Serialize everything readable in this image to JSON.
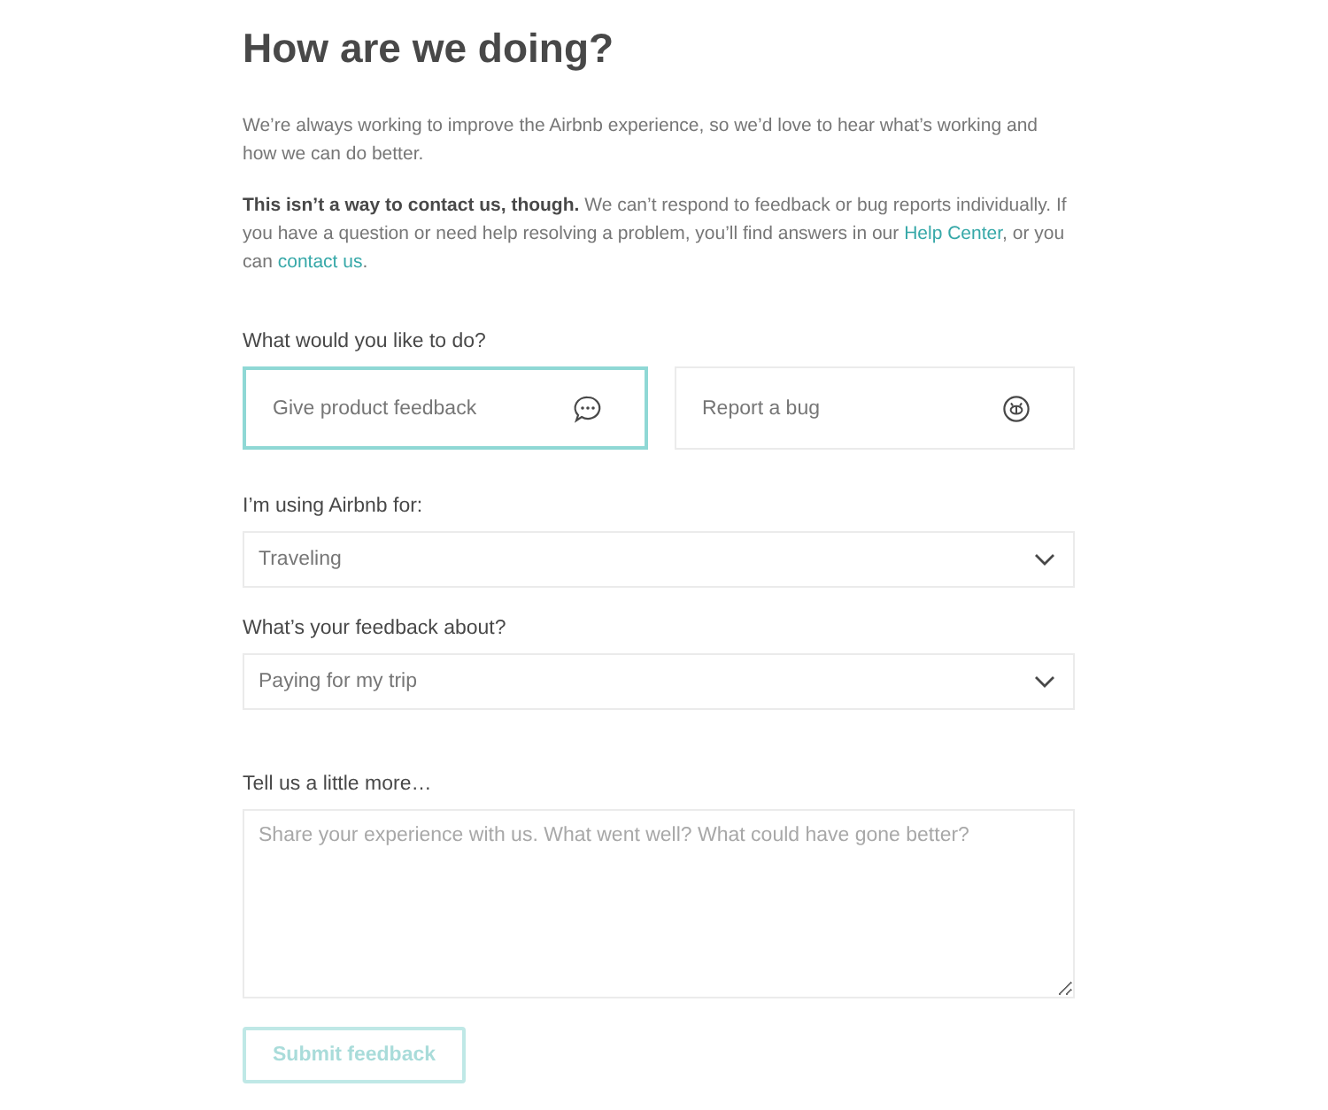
{
  "title": "How are we doing?",
  "intro": "We’re always working to improve the Airbnb experience, so we’d love to hear what’s working and how we can do better.",
  "notice": [
    {
      "kind": "bold",
      "text": "This isn’t a way to contact us, though."
    },
    {
      "kind": "text",
      "text": " We can’t respond to feedback or bug reports individually. If you have a question or need help resolving a problem, you’ll find answers in our "
    },
    {
      "kind": "link",
      "text": "Help Center"
    },
    {
      "kind": "text",
      "text": ", or you can "
    },
    {
      "kind": "link",
      "text": "contact us"
    },
    {
      "kind": "text",
      "text": "."
    }
  ],
  "action": {
    "label": "What would you like to do?",
    "options": [
      {
        "label": "Give product feedback",
        "kind": "chat",
        "selected": true
      },
      {
        "label": "Report a bug",
        "kind": "bug",
        "selected": false
      }
    ]
  },
  "selects": [
    {
      "label": "I’m using Airbnb for:",
      "value": "Traveling"
    },
    {
      "label": "What’s your feedback about?",
      "value": "Paying for my trip"
    }
  ],
  "details": {
    "label": "Tell us a little more…",
    "placeholder": "Share your experience with us. What went well? What could have gone better?"
  },
  "submit": {
    "label": "Submit feedback",
    "disabled": true
  }
}
